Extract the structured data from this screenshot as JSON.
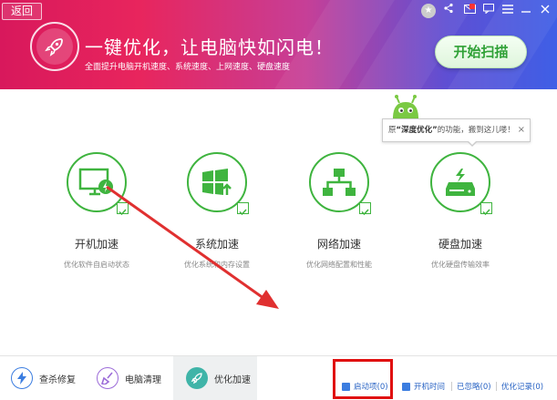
{
  "header": {
    "back_label": "返回",
    "title": "一键优化，让电脑快如闪电！",
    "subtitle": "全面提升电脑开机速度、系统速度、上网速度、硬盘速度",
    "scan_button": "开始扫描",
    "skin_badge": "★",
    "colors": {
      "gradient_start": "#d8185c",
      "gradient_end": "#3f5fe6",
      "scan_text": "#2fa136"
    }
  },
  "tooltip": {
    "prefix": "原",
    "highlight": "“深度优化”",
    "suffix": "的功能，搬到这儿喽！",
    "close": "×"
  },
  "tiles": [
    {
      "name": "开机加速",
      "desc": "优化软件自启动状态",
      "icon": "monitor-lightning-icon"
    },
    {
      "name": "系统加速",
      "desc": "优化系统和内存设置",
      "icon": "windows-upgrade-icon"
    },
    {
      "name": "网络加速",
      "desc": "优化网络配置和性能",
      "icon": "network-topology-icon"
    },
    {
      "name": "硬盘加速",
      "desc": "优化硬盘传输效率",
      "icon": "harddisk-lightning-icon"
    }
  ],
  "bottom": {
    "tabs": [
      {
        "label": "查杀修复",
        "icon": "lightning-shield-icon"
      },
      {
        "label": "电脑清理",
        "icon": "broom-icon"
      },
      {
        "label": "优化加速",
        "icon": "rocket-icon"
      }
    ],
    "links": [
      {
        "label": "启动项(0)"
      },
      {
        "label": "开机时间"
      },
      {
        "label": "已忽略(0)"
      },
      {
        "label": "优化记录(0)"
      }
    ]
  },
  "accent_green": "#3fb43f",
  "annotation_color": "#e01010"
}
